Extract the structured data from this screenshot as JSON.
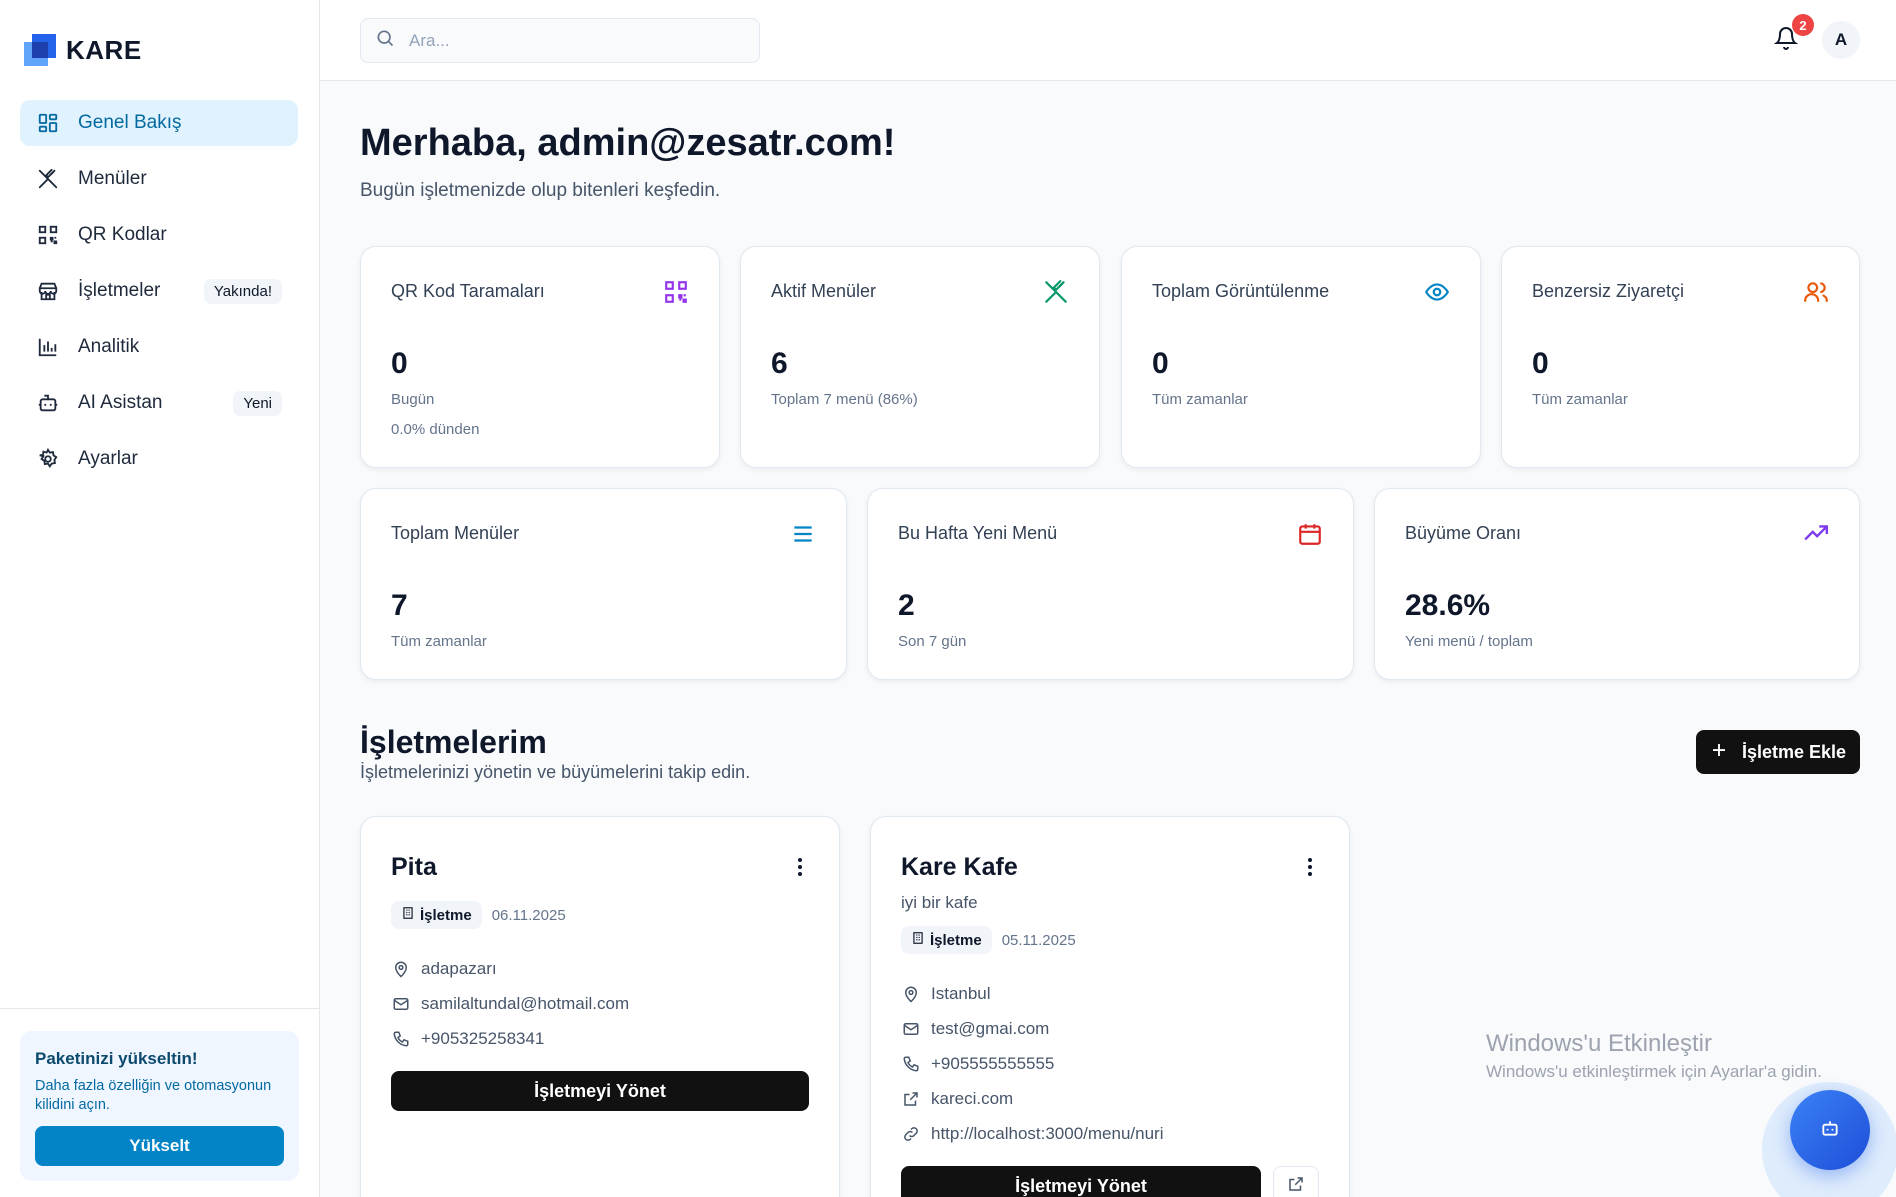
{
  "app": {
    "name": "KARE"
  },
  "sidebar": {
    "items": [
      {
        "label": "Genel Bakış",
        "icon": "layout-grid-icon",
        "active": true
      },
      {
        "label": "Menüler",
        "icon": "utensils-crossed-icon"
      },
      {
        "label": "QR Kodlar",
        "icon": "qr-code-icon"
      },
      {
        "label": "İşletmeler",
        "icon": "store-icon",
        "badge": "Yakında!"
      },
      {
        "label": "Analitik",
        "icon": "bar-chart-icon"
      },
      {
        "label": "AI Asistan",
        "icon": "bot-icon",
        "badge": "Yeni"
      },
      {
        "label": "Ayarlar",
        "icon": "settings-icon"
      }
    ],
    "upgrade": {
      "title": "Paketinizi yükseltin!",
      "text": "Daha fazla özelliğin ve otomasyonun kilidini açın.",
      "button": "Yükselt"
    }
  },
  "topbar": {
    "search_placeholder": "Ara...",
    "notification_count": "2",
    "avatar_initial": "A"
  },
  "greeting": {
    "title": "Merhaba, admin@zesatr.com!",
    "subtitle": "Bugün işletmenizde olup bitenleri keşfedin."
  },
  "stats_row1": [
    {
      "title": "QR Kod Taramaları",
      "value": "0",
      "sub": "Bugün",
      "sub2": "0.0% dünden",
      "icon": "qr-code-icon",
      "color": "#9333ea"
    },
    {
      "title": "Aktif Menüler",
      "value": "6",
      "sub": "Toplam 7 menü (86%)",
      "icon": "utensils-crossed-icon",
      "color": "#059669"
    },
    {
      "title": "Toplam Görüntülenme",
      "value": "0",
      "sub": "Tüm zamanlar",
      "icon": "eye-icon",
      "color": "#0284c7"
    },
    {
      "title": "Benzersiz Ziyaretçi",
      "value": "0",
      "sub": "Tüm zamanlar",
      "icon": "users-icon",
      "color": "#ea580c"
    }
  ],
  "stats_row2": [
    {
      "title": "Toplam Menüler",
      "value": "7",
      "sub": "Tüm zamanlar",
      "icon": "list-icon",
      "color": "#0284c7"
    },
    {
      "title": "Bu Hafta Yeni Menü",
      "value": "2",
      "sub": "Son 7 gün",
      "icon": "calendar-icon",
      "color": "#dc2626"
    },
    {
      "title": "Büyüme Oranı",
      "value": "28.6%",
      "sub": "Yeni menü / toplam",
      "icon": "trending-up-icon",
      "color": "#7c3aed"
    }
  ],
  "businesses_section": {
    "title": "İşletmelerim",
    "subtitle": "İşletmelerinizi yönetin ve büyümelerini takip edin.",
    "add_button": "İşletme Ekle"
  },
  "businesses": [
    {
      "name": "Pita",
      "tag": "İşletme",
      "date": "06.11.2025",
      "location": "adapazarı",
      "email": "samilaltundal@hotmail.com",
      "phone": "+905325258341",
      "manage_button": "İşletmeyi Yönet"
    },
    {
      "name": "Kare Kafe",
      "description": "iyi bir kafe",
      "tag": "İşletme",
      "date": "05.11.2025",
      "location": "Istanbul",
      "email": "test@gmai.com",
      "phone": "+905555555555",
      "website": "kareci.com",
      "menu_link": "http://localhost:3000/menu/nuri",
      "manage_button": "İşletmeyi Yönet"
    }
  ],
  "watermark": {
    "line1": "Windows'u Etkinleştir",
    "line2": "Windows'u etkinleştirmek için Ayarlar'a gidin."
  }
}
